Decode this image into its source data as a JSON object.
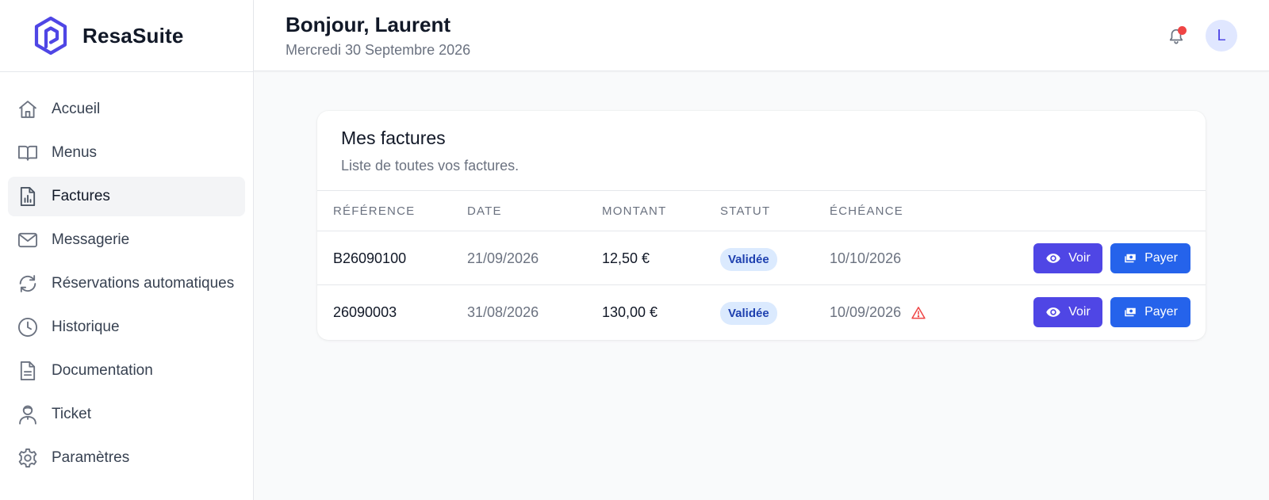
{
  "brand": {
    "name": "ResaSuite"
  },
  "sidebar": {
    "items": [
      {
        "label": "Accueil",
        "icon": "home-icon",
        "active": false
      },
      {
        "label": "Menus",
        "icon": "book-open-icon",
        "active": false
      },
      {
        "label": "Factures",
        "icon": "chart-document-icon",
        "active": true
      },
      {
        "label": "Messagerie",
        "icon": "mail-icon",
        "active": false
      },
      {
        "label": "Réservations automatiques",
        "icon": "refresh-icon",
        "active": false
      },
      {
        "label": "Historique",
        "icon": "clock-icon",
        "active": false
      },
      {
        "label": "Documentation",
        "icon": "document-icon",
        "active": false
      },
      {
        "label": "Ticket",
        "icon": "support-agent-icon",
        "active": false
      },
      {
        "label": "Paramètres",
        "icon": "gear-icon",
        "active": false
      }
    ]
  },
  "header": {
    "greeting": "Bonjour, Laurent",
    "date": "Mercredi 30 Septembre 2026",
    "avatar_initial": "L",
    "has_notification": true
  },
  "invoices": {
    "title": "Mes factures",
    "subtitle": "Liste de toutes vos factures.",
    "columns": {
      "reference": "RÉFÉRENCE",
      "date": "DATE",
      "amount": "MONTANT",
      "status": "STATUT",
      "due": "ÉCHÉANCE"
    },
    "rows": [
      {
        "reference": "B26090100",
        "date": "21/09/2026",
        "amount": "12,50 €",
        "status": "Validée",
        "due": "10/10/2026",
        "overdue": false,
        "view_label": "Voir",
        "pay_label": "Payer"
      },
      {
        "reference": "26090003",
        "date": "31/08/2026",
        "amount": "130,00 €",
        "status": "Validée",
        "due": "10/09/2026",
        "overdue": true,
        "view_label": "Voir",
        "pay_label": "Payer"
      }
    ]
  },
  "colors": {
    "brand": "#4f46e5",
    "view_button": "#4f46e5",
    "pay_button": "#2563eb",
    "badge_bg": "#dbeafe",
    "badge_text": "#1e40af",
    "notification_dot": "#ef4444",
    "warning": "#ef4444"
  }
}
